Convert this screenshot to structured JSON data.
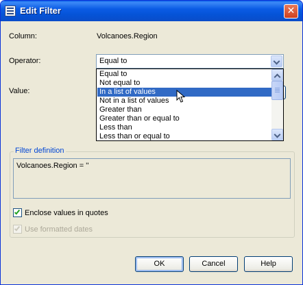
{
  "window": {
    "title": "Edit Filter",
    "close_glyph": "✕"
  },
  "column": {
    "label": "Column:",
    "value": "Volcanoes.Region"
  },
  "operator": {
    "label": "Operator:",
    "selected": "Equal to",
    "options": [
      "Equal to",
      "Not equal to",
      "In a list of values",
      "Not in a list of values",
      "Greater than",
      "Greater than or equal to",
      "Less than",
      "Less than or equal to"
    ],
    "highlighted_option": "In a list of values"
  },
  "value": {
    "label": "Value:"
  },
  "filter_definition": {
    "label": "Filter definition",
    "text": "Volcanoes.Region = ''"
  },
  "checkboxes": {
    "enclose_quotes": {
      "label": "Enclose values in quotes",
      "checked": true,
      "enabled": true
    },
    "formatted_dates": {
      "label": "Use formatted dates",
      "checked": true,
      "enabled": false
    }
  },
  "buttons": {
    "ok": "OK",
    "cancel": "Cancel",
    "help": "Help"
  },
  "colors": {
    "titlebar": "#0553d6",
    "selection": "#316ac5",
    "group_label": "#0046d5",
    "dialog_bg": "#ece9d8"
  },
  "icons": {
    "app": "filter-dialog-icon",
    "close": "close-icon",
    "dropdown": "chevron-down-icon",
    "scroll_up": "chevron-up-icon",
    "scroll_down": "chevron-down-icon",
    "cursor": "mouse-pointer-icon"
  }
}
